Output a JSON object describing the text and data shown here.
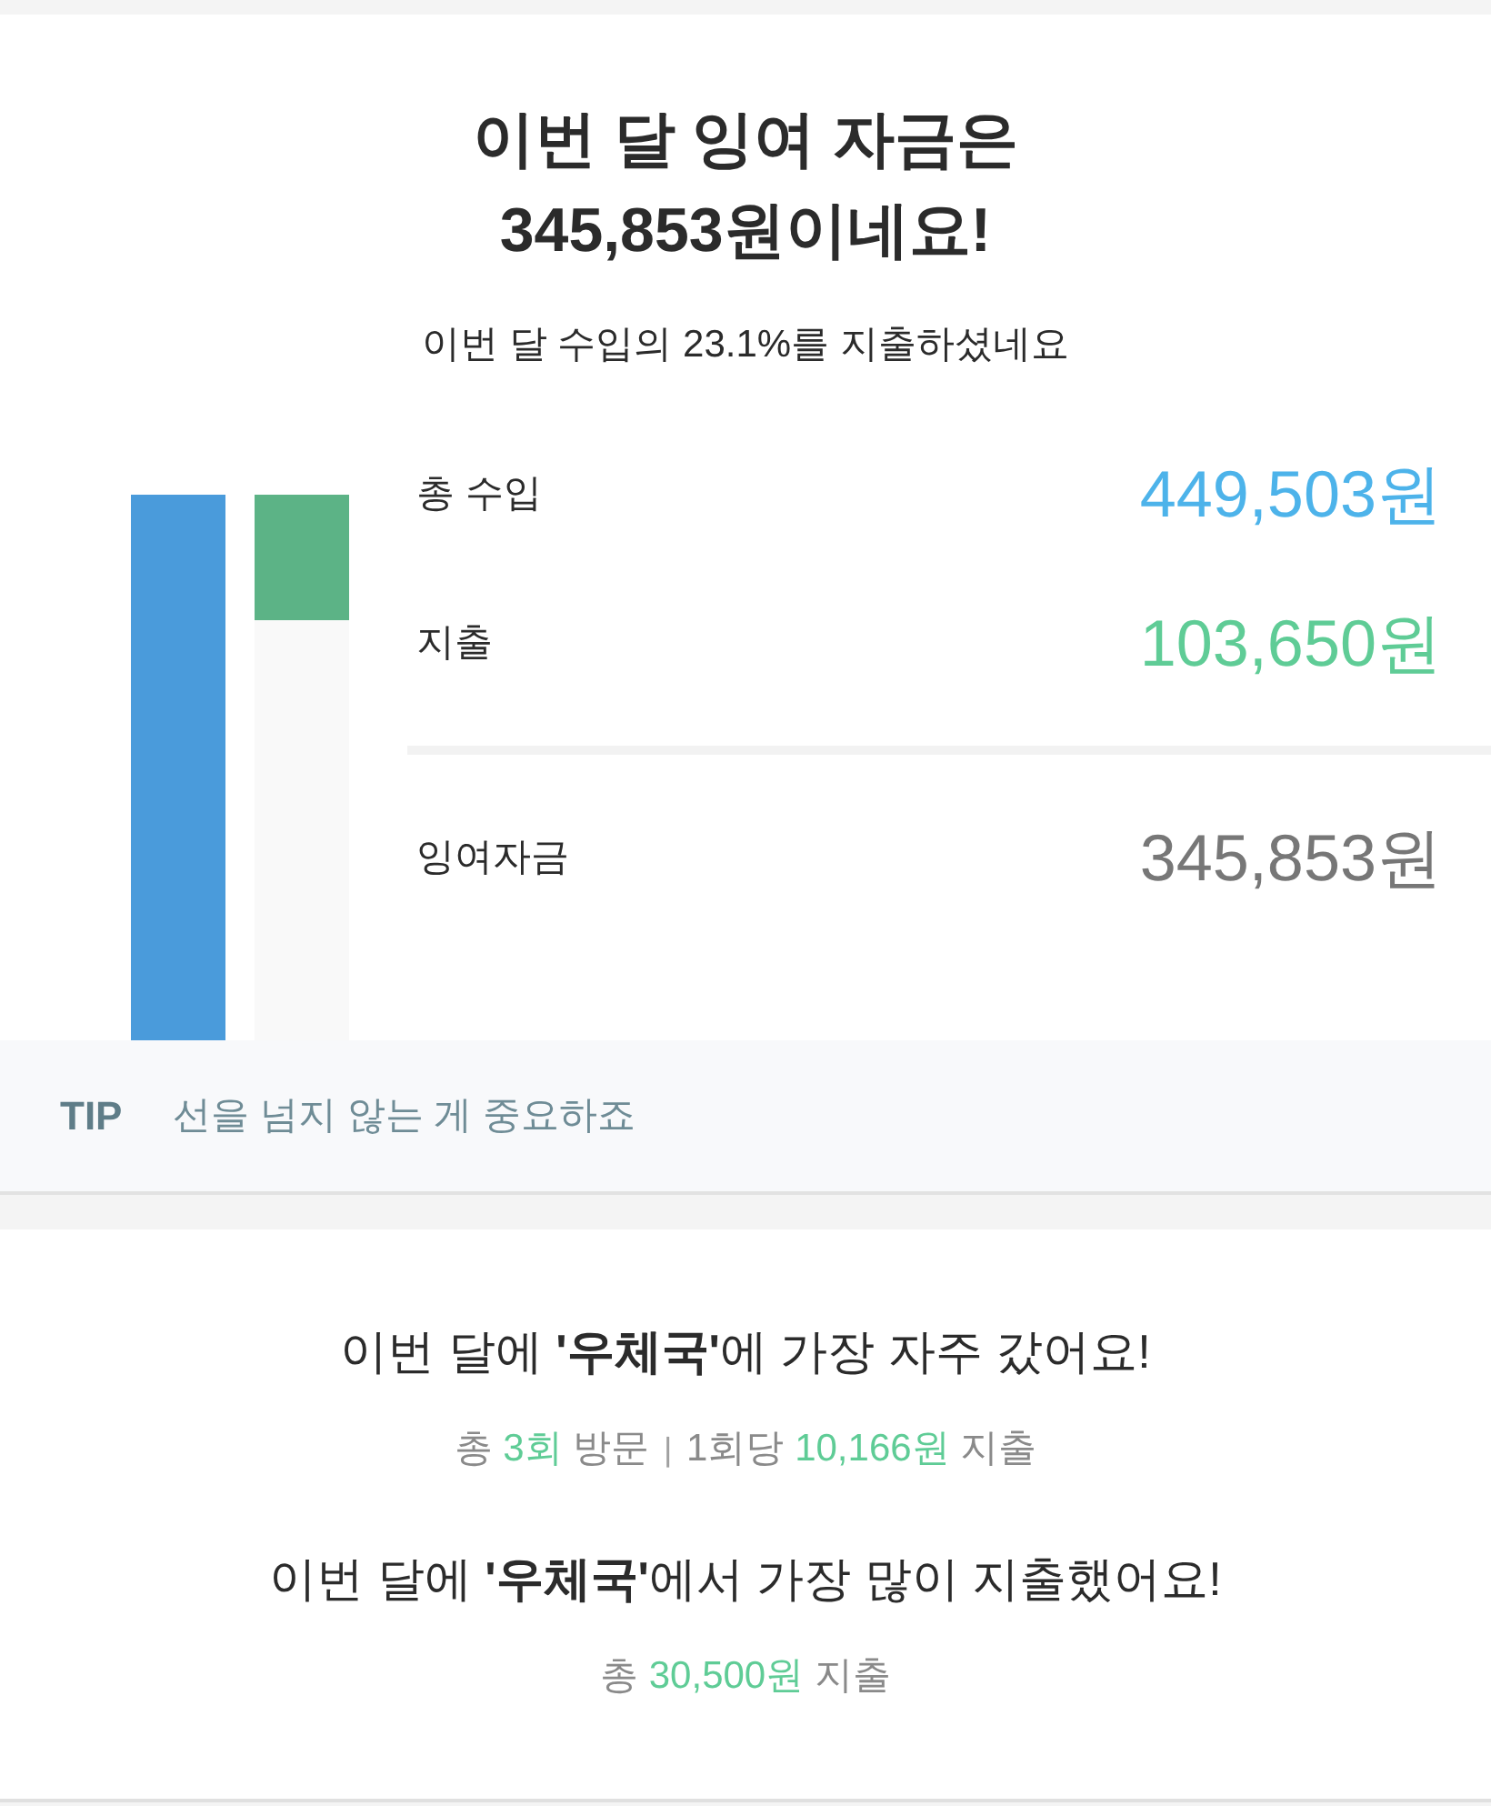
{
  "summary": {
    "title_lines": [
      "이번 달 잉여 자금은",
      "345,853원이네요!"
    ],
    "subtitle": "이번 달 수입의 23.1%를 지출하셨네요",
    "bars": [
      {
        "level": 1,
        "color": "#4a9bdb"
      },
      {
        "level": 0.231,
        "color": "#5cb386"
      }
    ],
    "rows": [
      {
        "kind": "income",
        "label": "총 수입",
        "value": "449,503원"
      },
      {
        "kind": "expense",
        "label": "지출",
        "value": "103,650원"
      }
    ],
    "total": {
      "label": "잉여자금",
      "value": "345,853원"
    },
    "tip": {
      "badge": "TIP",
      "text": "선을 넘지 않는 게 중요하죠"
    }
  },
  "insights": [
    {
      "headline": "이번 달에 **'우체국'**에 가장 자주 갔어요!",
      "detail": [
        {
          "kind": "plain",
          "text": "총 "
        },
        {
          "kind": "highlight",
          "text": "3회"
        },
        {
          "kind": "plain",
          "text": " 방문 "
        },
        {
          "kind": "divider",
          "text": "|"
        },
        {
          "kind": "plain",
          "text": " 1회당 "
        },
        {
          "kind": "highlight",
          "text": "10,166원"
        },
        {
          "kind": "plain",
          "text": " 지출"
        }
      ]
    },
    {
      "headline": "이번 달에 **'우체국'**에서 가장 많이 지출했어요!",
      "detail": [
        {
          "kind": "plain",
          "text": "총 "
        },
        {
          "kind": "highlight",
          "text": "30,500원"
        },
        {
          "kind": "plain",
          "text": " 지출"
        }
      ]
    }
  ]
}
